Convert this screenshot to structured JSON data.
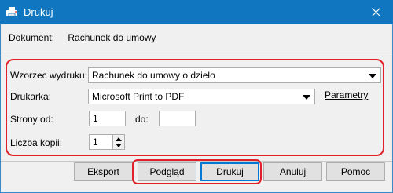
{
  "window": {
    "title": "Drukuj",
    "colors": {
      "titlebar": "#0f76bf",
      "highlight": "#e0202a"
    }
  },
  "document": {
    "label": "Dokument:",
    "value": "Rachunek do umowy"
  },
  "form": {
    "template_label": "Wzorzec wydruku:",
    "template_value": "Rachunek do umowy o dzieło",
    "printer_label": "Drukarka:",
    "printer_value": "Microsoft Print to PDF",
    "parameters_link": "Parametry",
    "pages_from_label": "Strony od:",
    "pages_from_value": "1",
    "pages_to_label": "do:",
    "pages_to_value": "",
    "copies_label": "Liczba kopii:",
    "copies_value": "1"
  },
  "buttons": {
    "export": "Eksport",
    "preview": "Podgląd",
    "print": "Drukuj",
    "cancel": "Anuluj",
    "help": "Pomoc"
  },
  "icons": {
    "app": "printer-app-icon",
    "close": "close-icon"
  }
}
